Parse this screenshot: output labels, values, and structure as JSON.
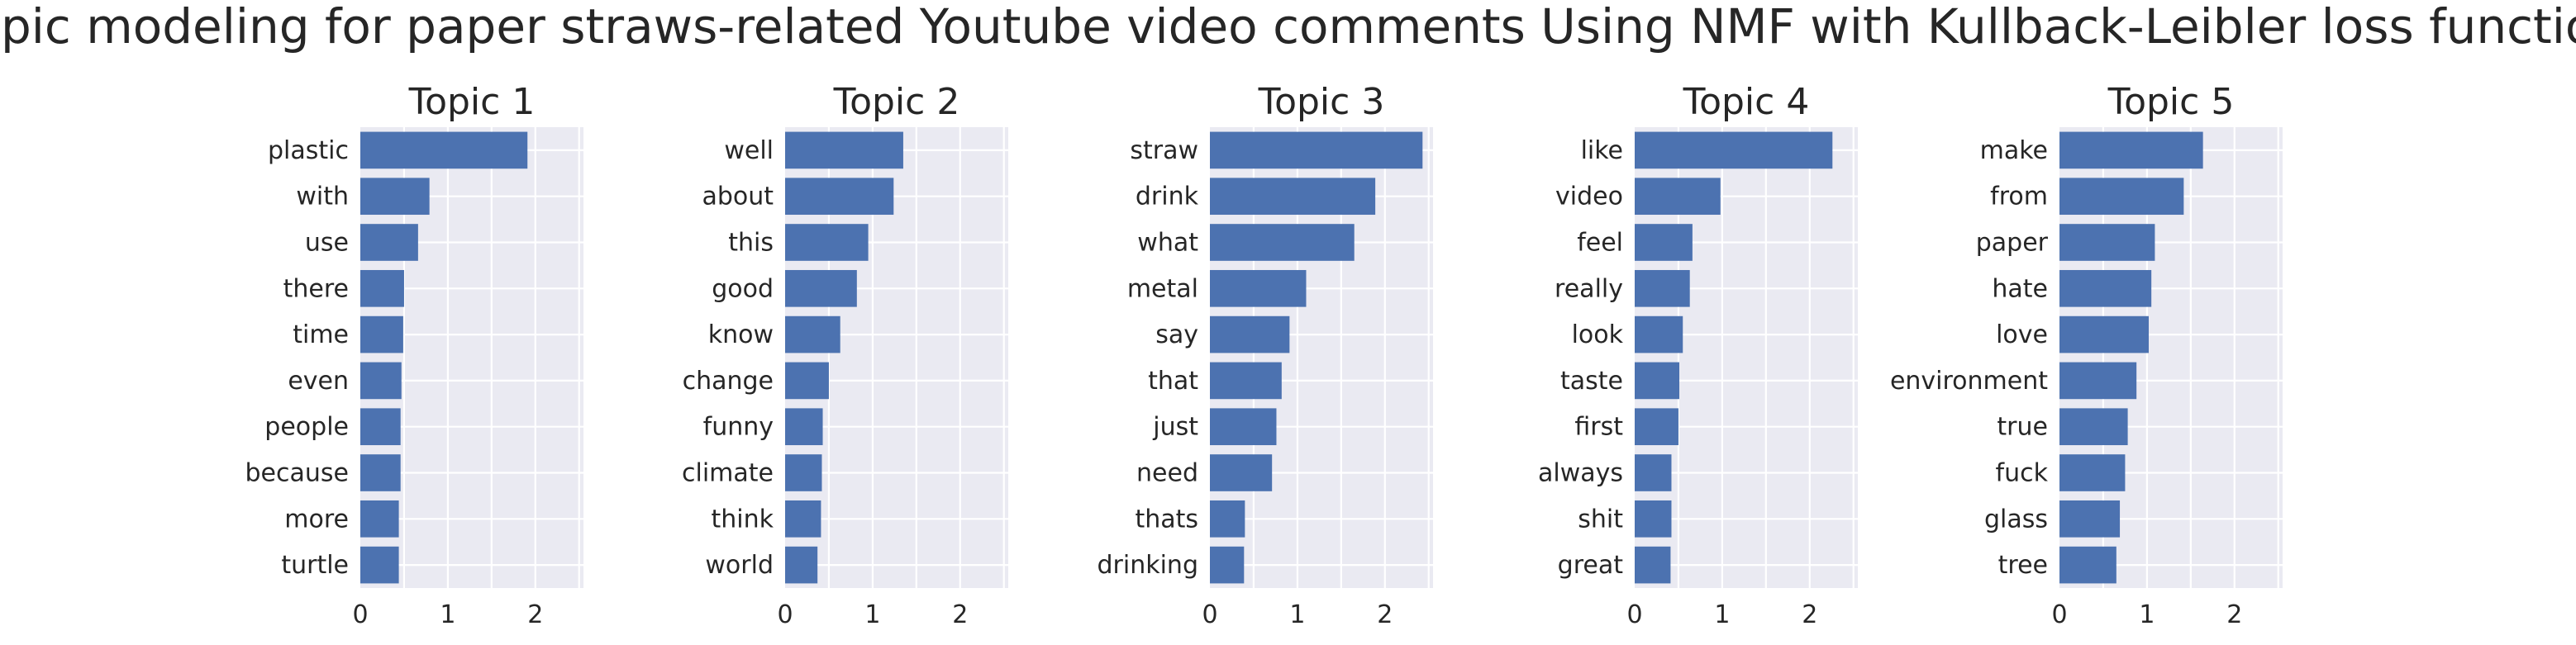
{
  "suptitle": "Topic modeling for paper straws-related Youtube video comments Using NMF with Kullback-Leibler loss function",
  "colors": {
    "background": "#ffffff",
    "plot_background": "#eaeaf2",
    "grid": "#ffffff",
    "bar": "#4c72b0",
    "text": "#262626"
  },
  "chart_data": [
    {
      "type": "bar",
      "orientation": "horizontal",
      "title": "Topic 1",
      "categories": [
        "plastic",
        "with",
        "use",
        "there",
        "time",
        "even",
        "people",
        "because",
        "more",
        "turtle"
      ],
      "values": [
        1.91,
        0.79,
        0.66,
        0.5,
        0.49,
        0.47,
        0.46,
        0.46,
        0.44,
        0.44
      ],
      "xlim": [
        0,
        2.55
      ],
      "xticks": [
        "0",
        "1",
        "2"
      ],
      "grid": true
    },
    {
      "type": "bar",
      "orientation": "horizontal",
      "title": "Topic 2",
      "categories": [
        "well",
        "about",
        "this",
        "good",
        "know",
        "change",
        "funny",
        "climate",
        "think",
        "world"
      ],
      "values": [
        1.35,
        1.24,
        0.95,
        0.82,
        0.63,
        0.5,
        0.43,
        0.42,
        0.41,
        0.37
      ],
      "xlim": [
        0,
        2.55
      ],
      "xticks": [
        "0",
        "1",
        "2"
      ],
      "grid": true
    },
    {
      "type": "bar",
      "orientation": "horizontal",
      "title": "Topic 3",
      "categories": [
        "straw",
        "drink",
        "what",
        "metal",
        "say",
        "that",
        "just",
        "need",
        "thats",
        "drinking"
      ],
      "values": [
        2.43,
        1.89,
        1.65,
        1.1,
        0.91,
        0.82,
        0.76,
        0.71,
        0.4,
        0.39
      ],
      "xlim": [
        0,
        2.55
      ],
      "xticks": [
        "0",
        "1",
        "2"
      ],
      "grid": true
    },
    {
      "type": "bar",
      "orientation": "horizontal",
      "title": "Topic 4",
      "categories": [
        "like",
        "video",
        "feel",
        "really",
        "look",
        "taste",
        "first",
        "always",
        "shit",
        "great"
      ],
      "values": [
        2.26,
        0.98,
        0.66,
        0.63,
        0.55,
        0.51,
        0.5,
        0.42,
        0.42,
        0.41
      ],
      "xlim": [
        0,
        2.55
      ],
      "xticks": [
        "0",
        "1",
        "2"
      ],
      "grid": true
    },
    {
      "type": "bar",
      "orientation": "horizontal",
      "title": "Topic 5",
      "categories": [
        "make",
        "from",
        "paper",
        "hate",
        "love",
        "environment",
        "true",
        "fuck",
        "glass",
        "tree"
      ],
      "values": [
        1.64,
        1.42,
        1.09,
        1.05,
        1.02,
        0.88,
        0.78,
        0.75,
        0.69,
        0.65
      ],
      "xlim": [
        0,
        2.55
      ],
      "xticks": [
        "0",
        "1",
        "2"
      ],
      "grid": true
    }
  ]
}
